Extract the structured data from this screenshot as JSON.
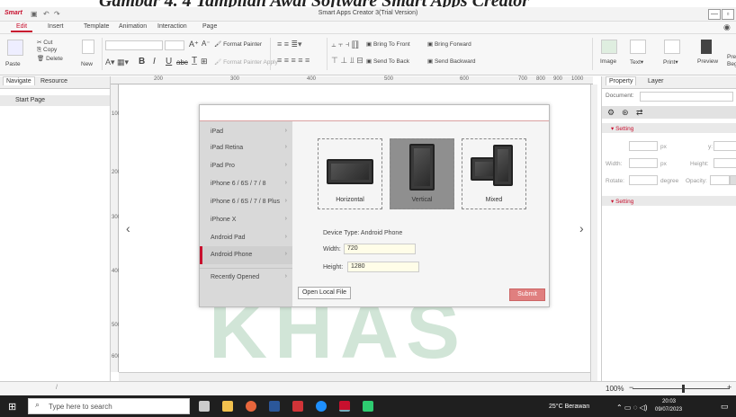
{
  "caption": "Gambar 4. 4 Tampilan Awal Software Smart Apps Creator",
  "app": {
    "logo": "Smart",
    "title": "Smart Apps Creator 3(Trial Version)"
  },
  "menu": [
    "Edit",
    "Insert",
    "Template",
    "Animation",
    "Interaction",
    "Page"
  ],
  "toolbar": {
    "paste": "Paste",
    "cut": "Cut",
    "copy": "Copy",
    "delete": "Delete",
    "new": "New",
    "format_painter": "Format Painter",
    "format_painter_apply": "Format Painter Apply",
    "bring_to_front": "Bring To Front",
    "bring_forward": "Bring Forward",
    "send_to_back": "Send To Back",
    "send_backward": "Send Backward",
    "image": "Image",
    "text": "Text",
    "print": "Print",
    "preview": "Preview",
    "pre_beg": "Pre Beg"
  },
  "left_tabs": [
    "Navigate",
    "Resource"
  ],
  "start_page": "Start Page",
  "ruler": [
    "200",
    "300",
    "400",
    "500",
    "600",
    "700",
    "800",
    "900",
    "1000"
  ],
  "ruler_left": [
    "100",
    "200",
    "300",
    "400",
    "500",
    "600"
  ],
  "dialog": {
    "devices": [
      "iPad",
      "iPad Retina",
      "iPad Pro",
      "iPhone 6 / 6S / 7 / 8",
      "iPhone 6 / 6S / 7 / 8 Plus",
      "iPhone X",
      "Android Pad",
      "Android Phone",
      "Recently Opened"
    ],
    "orientations": [
      "Horizontal",
      "Vertical",
      "Mixed"
    ],
    "device_type": "Device Type:  Android Phone",
    "width_label": "Width:",
    "width_value": "720",
    "height_label": "Height:",
    "height_value": "1280",
    "open_local": "Open Local File",
    "submit": "Submit"
  },
  "property": {
    "tabs": [
      "Property",
      "Layer"
    ],
    "document_label": "Document:",
    "setting": "Setting",
    "x": "x:",
    "px": "px",
    "y": "y:",
    "width": "Width:",
    "height": "Height:",
    "rotate": "Rotate:",
    "degree": "degree",
    "opacity": "Opacity:",
    "setting2": "Setting"
  },
  "status": {
    "slash": "/",
    "zoom": "100%"
  },
  "taskbar": {
    "search_placeholder": "Type here to search",
    "weather": "25°C  Berawan",
    "time": "20:03",
    "date": "09/07/2023"
  },
  "watermark": "UIN KHAS"
}
